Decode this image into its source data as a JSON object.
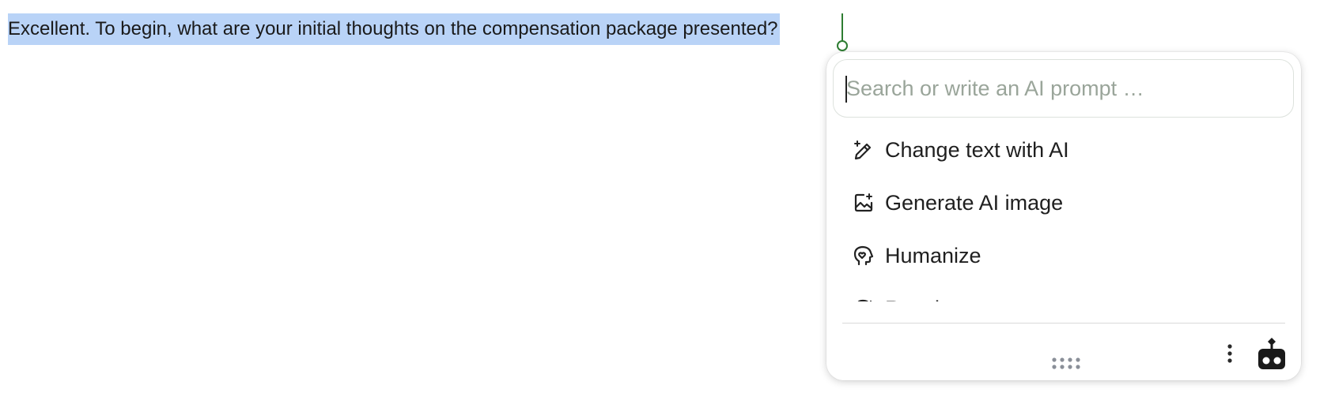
{
  "document": {
    "selected_text": "Excellent. To begin, what are your initial thoughts on the compensation package presented?"
  },
  "ai_panel": {
    "search": {
      "placeholder": "Search or write an AI prompt …",
      "value": ""
    },
    "menu_items": [
      {
        "label": "Change text with AI",
        "icon": "magic-pen-icon"
      },
      {
        "label": "Generate AI image",
        "icon": "image-sparkle-icon"
      },
      {
        "label": "Humanize",
        "icon": "head-heart-icon"
      },
      {
        "label": "Rewrite",
        "icon": "rewrite-icon"
      }
    ],
    "footer": {
      "drag_handle_icon": "drag-handle-icon",
      "more_icon": "more-vertical-icon",
      "bot_icon": "robot-icon"
    }
  },
  "colors": {
    "selection": "#b9d3f7",
    "caret": "#2e7d32",
    "placeholder": "#9aa59a"
  }
}
